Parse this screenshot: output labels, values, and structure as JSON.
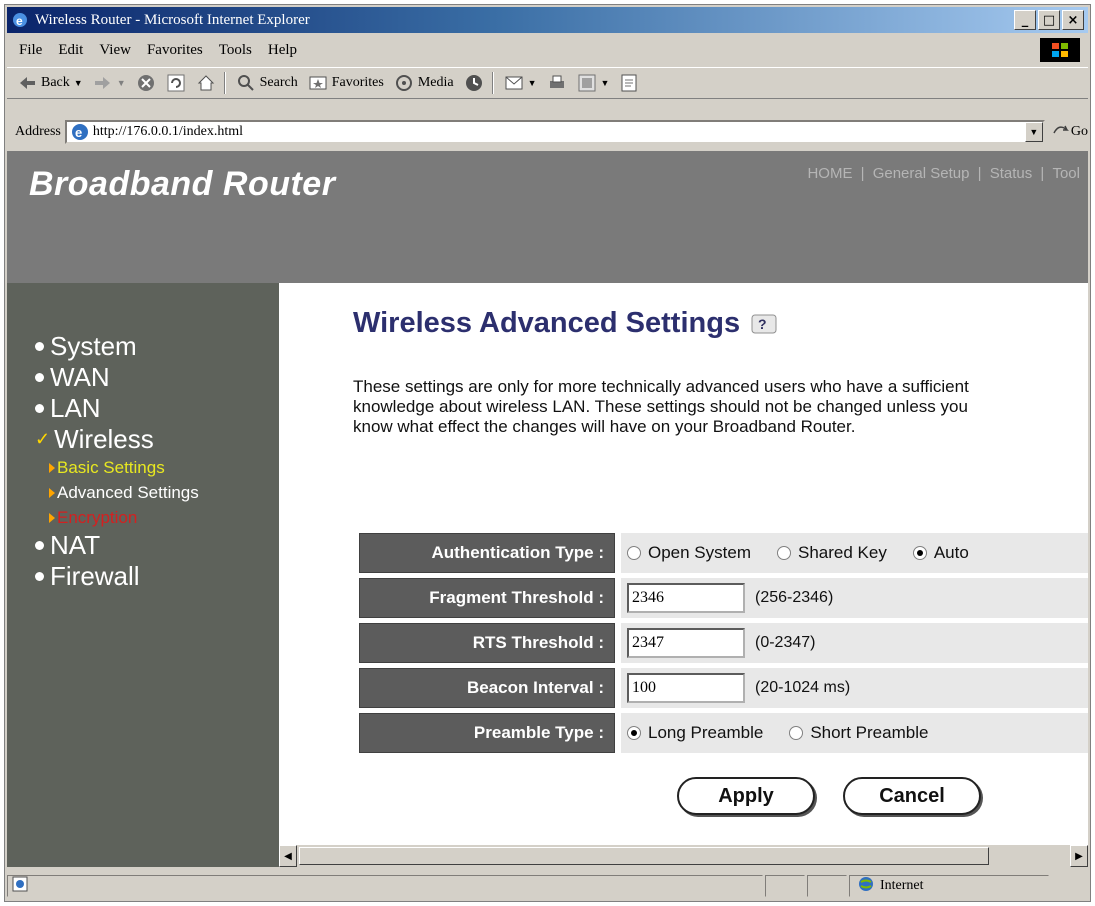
{
  "window": {
    "title": "Wireless Router - Microsoft Internet Explorer"
  },
  "menu": [
    "File",
    "Edit",
    "View",
    "Favorites",
    "Tools",
    "Help"
  ],
  "toolbar": {
    "back": "Back",
    "search": "Search",
    "favorites": "Favorites",
    "media": "Media"
  },
  "address": {
    "label": "Address",
    "url": "http://176.0.0.1/index.html",
    "go": "Go"
  },
  "header": {
    "brand": "Broadband Router",
    "nav": [
      "HOME",
      "General Setup",
      "Status",
      "Tool"
    ],
    "nav_sep": "|"
  },
  "sidebar": {
    "items": [
      {
        "label": "System"
      },
      {
        "label": "WAN"
      },
      {
        "label": "LAN"
      },
      {
        "label": "Wireless"
      },
      {
        "label": "NAT"
      },
      {
        "label": "Firewall"
      }
    ],
    "wireless_sub": [
      {
        "label": "Basic Settings",
        "color": "#e8e820"
      },
      {
        "label": "Advanced Settings",
        "color": "#ffffff"
      },
      {
        "label": "Encryption",
        "color": "#d42020"
      }
    ]
  },
  "main": {
    "title": "Wireless Advanced Settings",
    "description": "These settings are only for more technically advanced users who have a sufficient knowledge about wireless LAN. These settings should not be changed unless you know what effect the changes will have on your Broadband Router.",
    "auth": {
      "label": "Authentication Type :",
      "options": [
        "Open System",
        "Shared Key",
        "Auto"
      ],
      "selected": "Auto"
    },
    "fragment": {
      "label": "Fragment Threshold :",
      "value": "2346",
      "range": "(256-2346)"
    },
    "rts": {
      "label": "RTS Threshold :",
      "value": "2347",
      "range": "(0-2347)"
    },
    "beacon": {
      "label": "Beacon Interval :",
      "value": "100",
      "range": "(20-1024 ms)"
    },
    "preamble": {
      "label": "Preamble Type :",
      "options": [
        "Long Preamble",
        "Short Preamble"
      ],
      "selected": "Long Preamble"
    },
    "apply": "Apply",
    "cancel": "Cancel"
  },
  "status": {
    "zone": "Internet"
  },
  "colors": {
    "header_bg": "#7a7a7a",
    "sidebar_bg": "#5e625b",
    "title_color": "#2c2f6e",
    "label_bg": "#5c5c5c"
  }
}
